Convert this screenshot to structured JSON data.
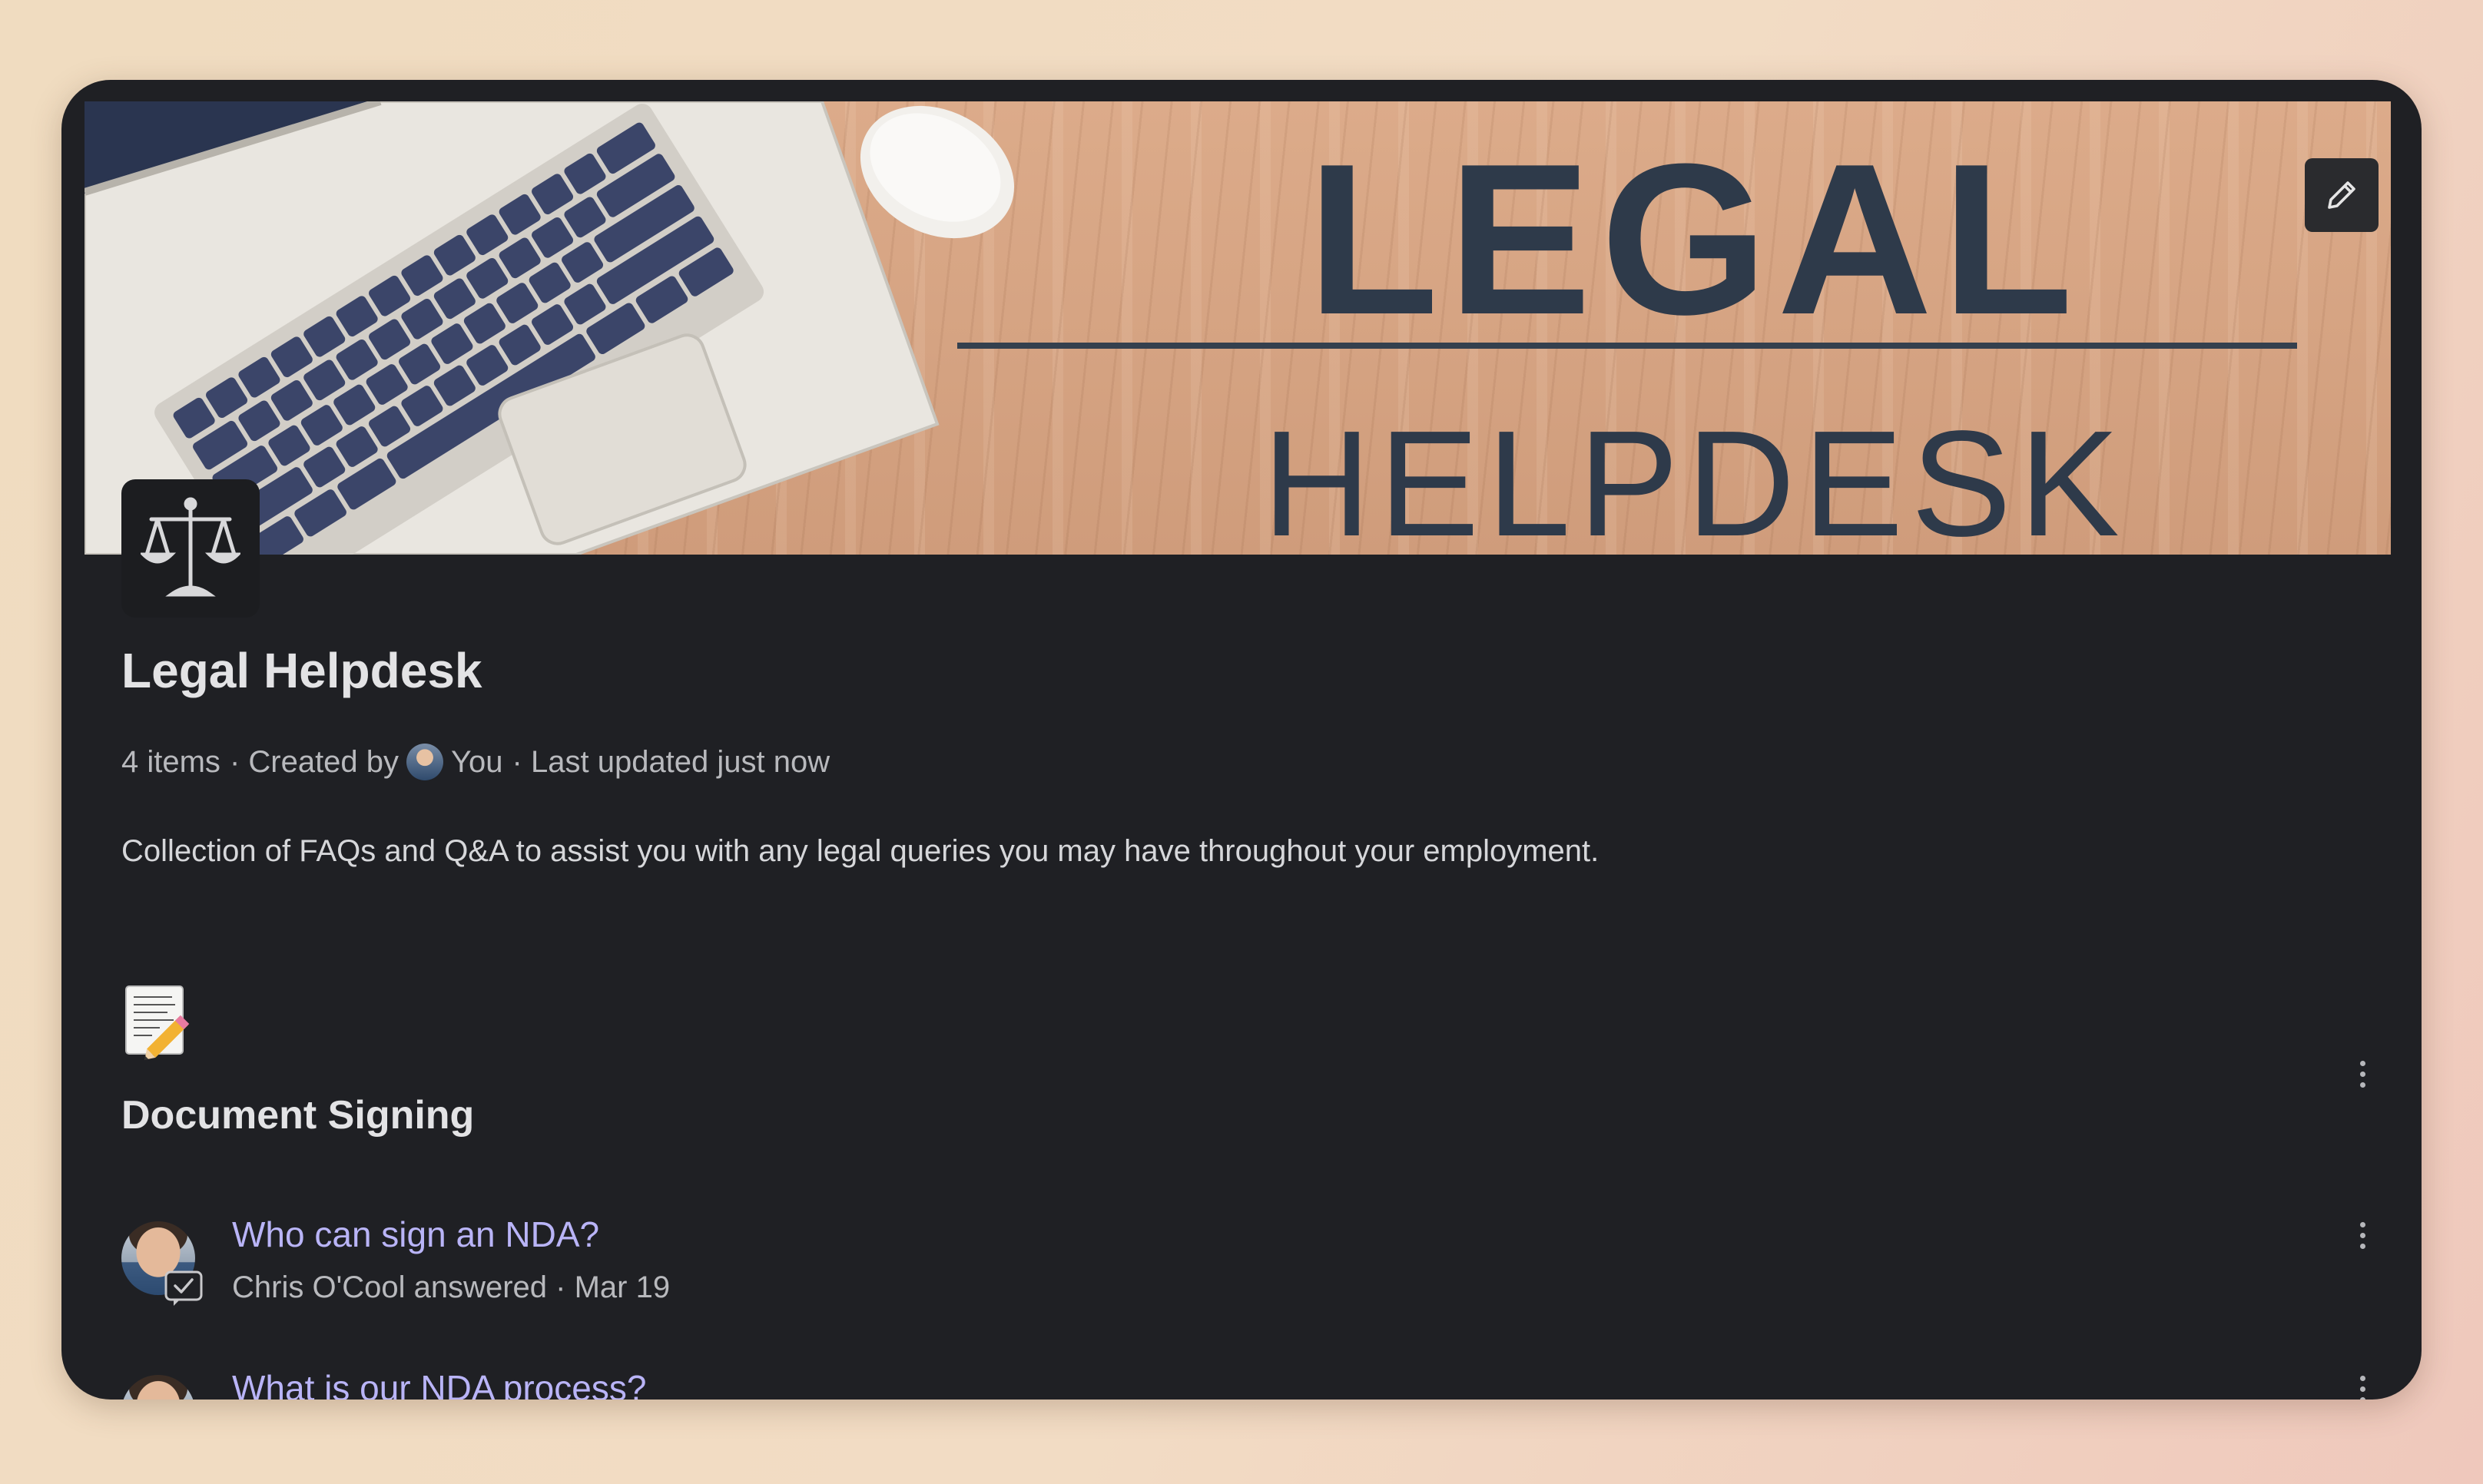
{
  "banner": {
    "title": "LEGAL",
    "subtitle": "HELPDESK"
  },
  "collection": {
    "title": "Legal Helpdesk",
    "items_count": "4 items",
    "created_by_label": "· Created by",
    "creator": "You",
    "updated": "· Last updated just now",
    "description": "Collection of FAQs and Q&A to assist you with any legal queries you may have throughout your employment."
  },
  "section": {
    "title": "Document Signing",
    "icon": "memo-pencil-emoji"
  },
  "questions": [
    {
      "title": "Who can sign an NDA?",
      "meta": "Chris O'Cool answered · Mar 19"
    },
    {
      "title": "What is our NDA process?",
      "meta": ""
    }
  ],
  "colors": {
    "card_bg": "#1f2024",
    "link": "#b9b4f7",
    "text_muted": "#b8b9bd",
    "banner_text": "#2e3a4a"
  }
}
